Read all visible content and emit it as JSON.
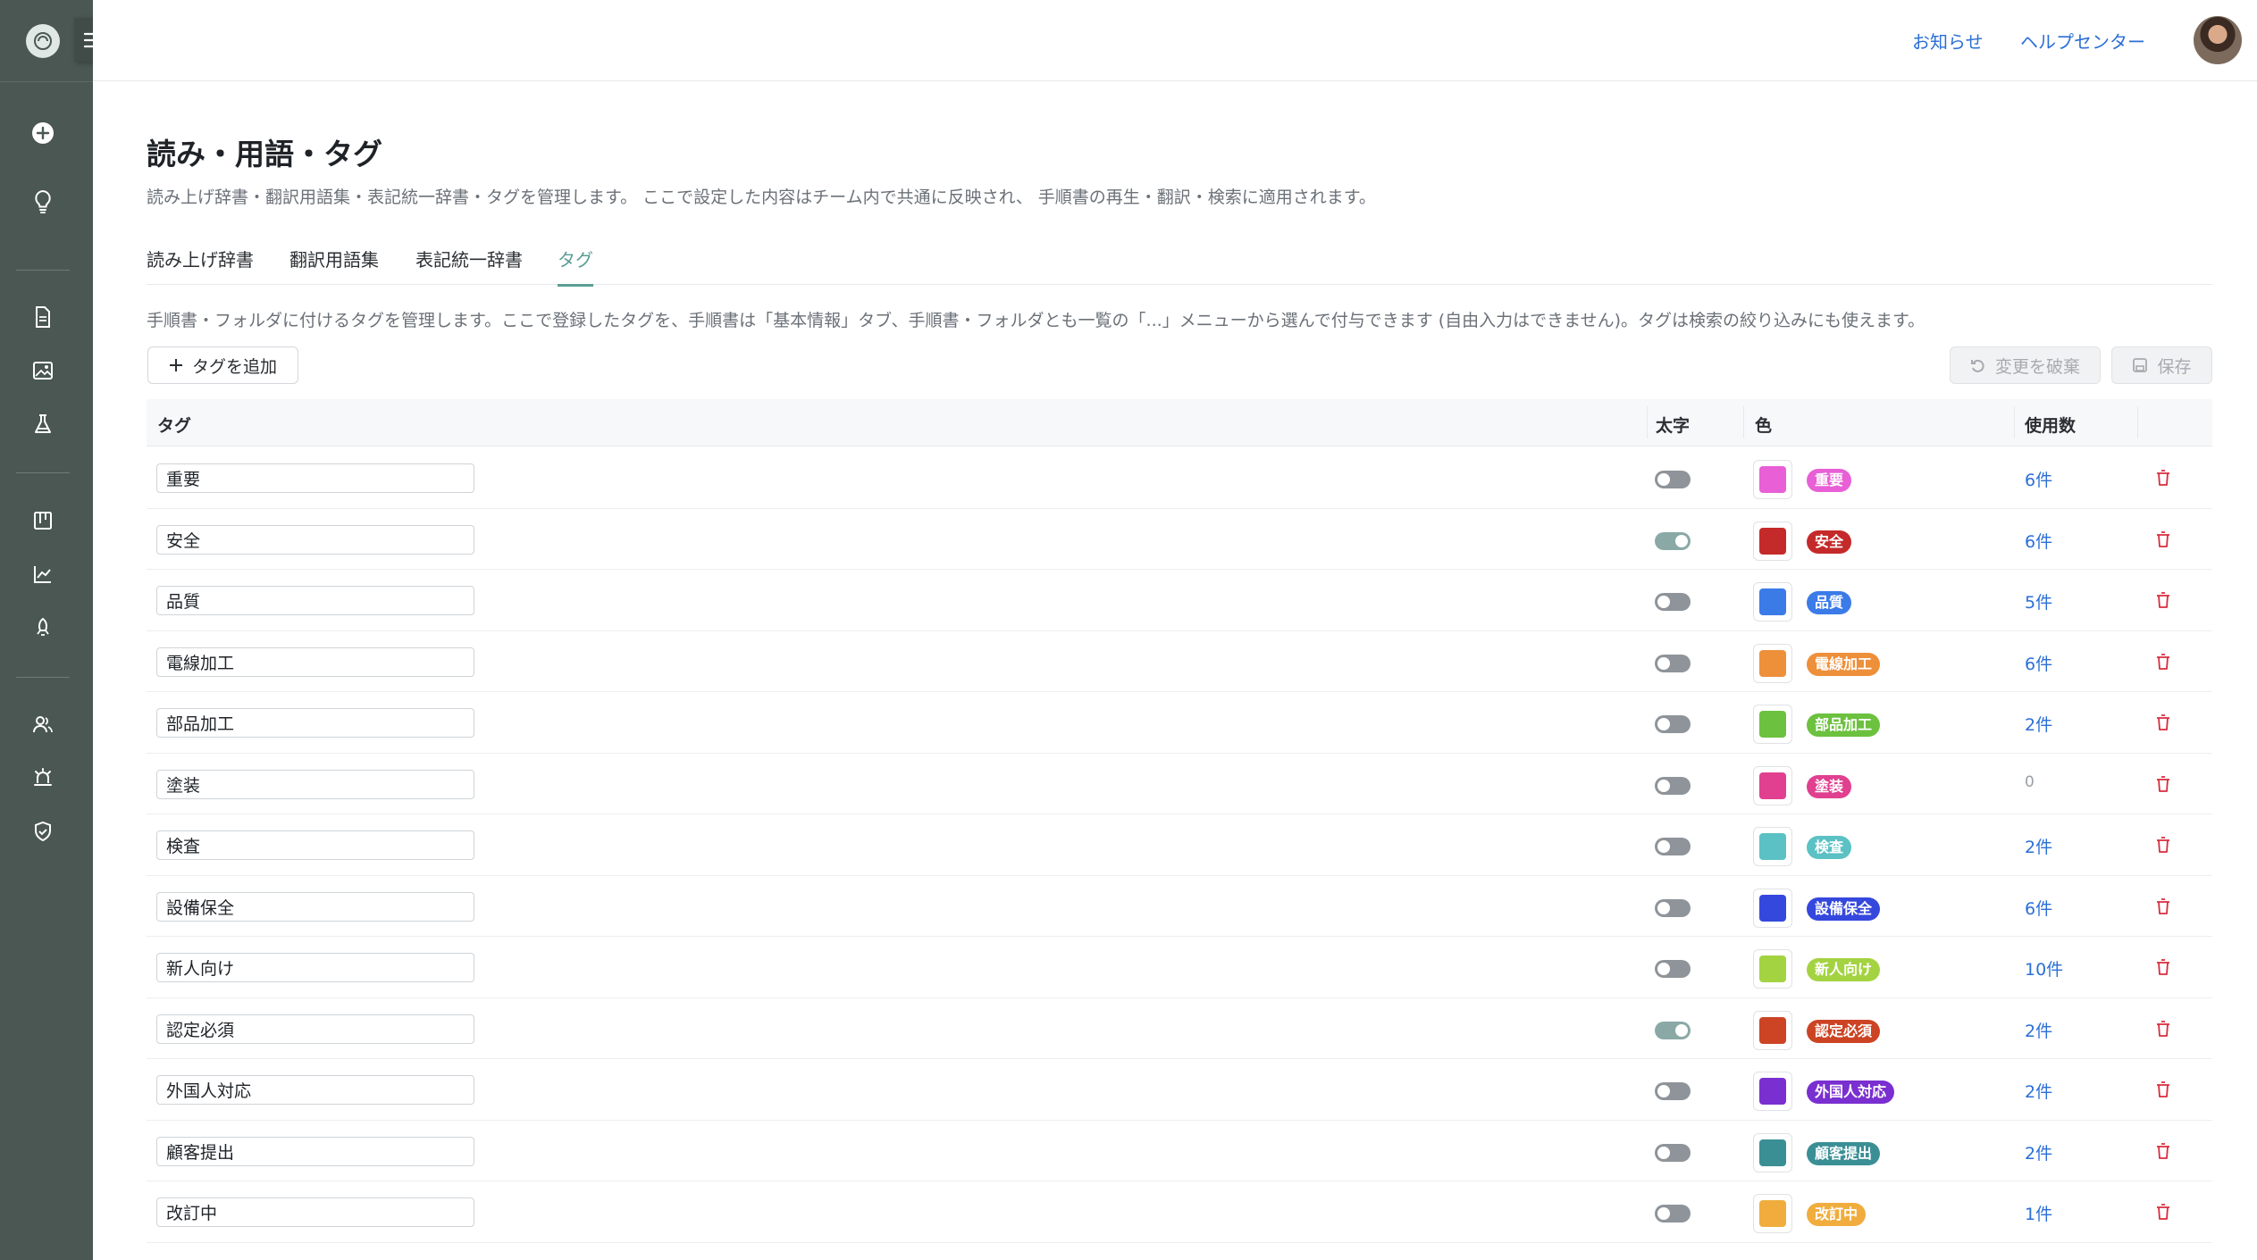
{
  "topbar": {
    "notifications": "お知らせ",
    "help": "ヘルプセンター"
  },
  "page": {
    "title": "読み・用語・タグ",
    "subtitle": "読み上げ辞書・翻訳用語集・表記統一辞書・タグを管理します。 ここで設定した内容はチーム内で共通に反映され、 手順書の再生・翻訳・検索に適用されます。"
  },
  "tabs": [
    {
      "label": "読み上げ辞書"
    },
    {
      "label": "翻訳用語集"
    },
    {
      "label": "表記統一辞書"
    },
    {
      "label": "タグ"
    }
  ],
  "tags_tab": {
    "description": "手順書・フォルダに付けるタグを管理します。ここで登録したタグを、手順書は「基本情報」タブ、手順書・フォルダとも一覧の「...」メニューから選んで付与できます (自由入力はできません)。タグは検索の絞り込みにも使えます。",
    "add_button": "タグを追加",
    "discard_button": "変更を破棄",
    "save_button": "保存",
    "columns": {
      "tag": "タグ",
      "bold": "太字",
      "color": "色",
      "usage": "使用数"
    },
    "rows": [
      {
        "name": "重要",
        "bold": false,
        "color": "#e85fd6",
        "usage": "6件"
      },
      {
        "name": "安全",
        "bold": true,
        "color": "#c52a2a",
        "usage": "6件"
      },
      {
        "name": "品質",
        "bold": false,
        "color": "#3b7be8",
        "usage": "5件"
      },
      {
        "name": "電線加工",
        "bold": false,
        "color": "#ee8f3a",
        "usage": "6件"
      },
      {
        "name": "部品加工",
        "bold": false,
        "color": "#6cc13f",
        "usage": "2件"
      },
      {
        "name": "塗装",
        "bold": false,
        "color": "#e0408f",
        "usage": "0"
      },
      {
        "name": "検査",
        "bold": false,
        "color": "#5bc1c4",
        "usage": "2件"
      },
      {
        "name": "設備保全",
        "bold": false,
        "color": "#3548dd",
        "usage": "6件"
      },
      {
        "name": "新人向け",
        "bold": false,
        "color": "#a4d342",
        "usage": "10件"
      },
      {
        "name": "認定必須",
        "bold": true,
        "color": "#cc4424",
        "usage": "2件"
      },
      {
        "name": "外国人対応",
        "bold": false,
        "color": "#7a2fd0",
        "usage": "2件"
      },
      {
        "name": "顧客提出",
        "bold": false,
        "color": "#3a8f95",
        "usage": "2件"
      },
      {
        "name": "改訂中",
        "bold": false,
        "color": "#f0ad3e",
        "usage": "1件"
      }
    ]
  },
  "colors": {
    "sidebar": "#4a5753",
    "accent": "#5a9e95",
    "link": "#2b6fd6",
    "danger": "#d92c3c"
  }
}
